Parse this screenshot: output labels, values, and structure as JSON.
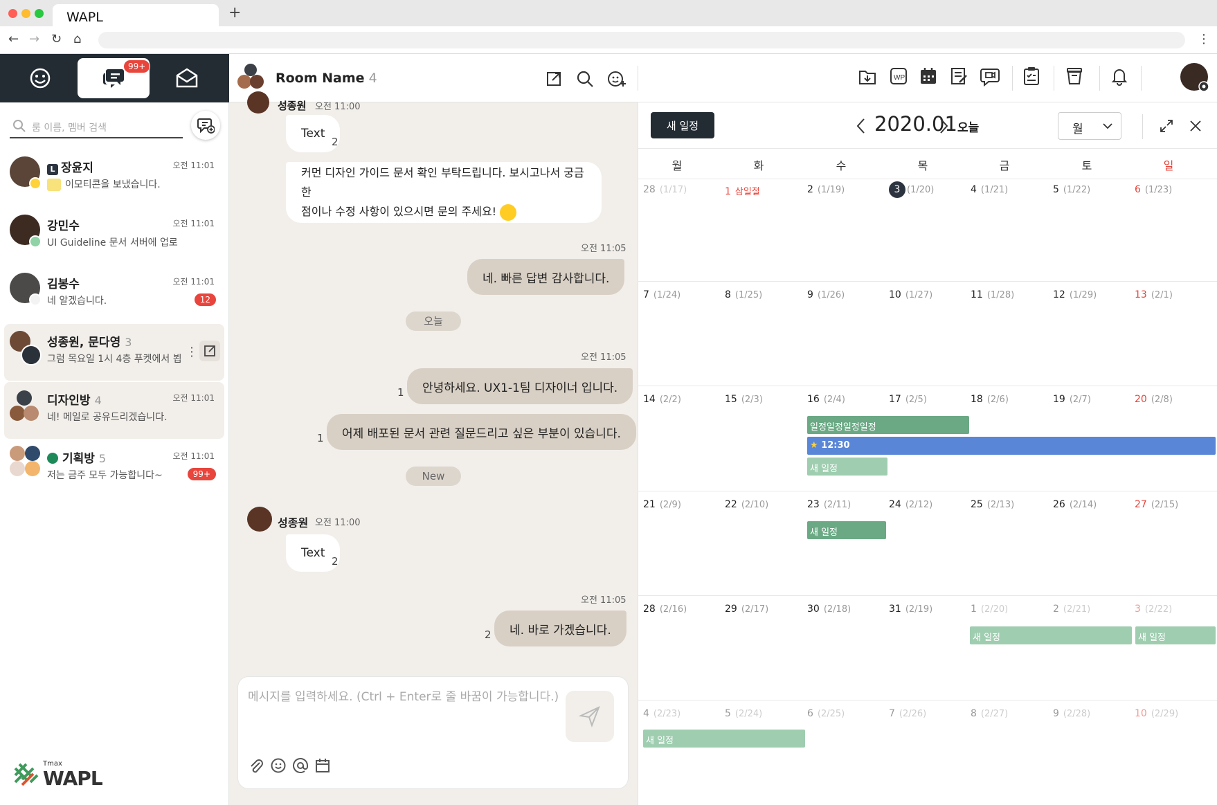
{
  "browser": {
    "tab_title": "WAPL",
    "new_tab": "+",
    "back": "←",
    "forward": "→",
    "reload": "↻",
    "home": "⌂",
    "menu": "⋮"
  },
  "left": {
    "tabs": [
      {
        "icon": "smile-icon"
      },
      {
        "icon": "chat-icon",
        "badge": "99+"
      },
      {
        "icon": "mail-icon"
      }
    ],
    "search_placeholder": "룸 이름, 멤버 검색",
    "rooms": [
      {
        "name": "장윤지",
        "count": "",
        "message": "이모티콘을 보냈습니다.",
        "time": "오전 11:01",
        "unread": ""
      },
      {
        "name": "강민수",
        "count": "",
        "message": "UI Guideline 문서 서버에 업로",
        "time": "오전 11:01",
        "unread": ""
      },
      {
        "name": "김봉수",
        "count": "",
        "message": "네 알겠습니다.",
        "time": "오전 11:01",
        "unread": "12"
      },
      {
        "name": "성종원, 문다영",
        "count": "3",
        "message": "그럼 목요일 1시 4층 푸켓에서 뵙",
        "time": "",
        "unread": ""
      },
      {
        "name": "디자인방",
        "count": "4",
        "message": "네! 메일로 공유드리겠습니다.",
        "time": "오전 11:01",
        "unread": ""
      },
      {
        "name": "기획방",
        "count": "5",
        "message": "저는 금주 모두 가능합니다~",
        "time": "오전 11:01",
        "unread": "99+"
      }
    ],
    "logo_brand": "Tmax",
    "logo_text": "WAPL"
  },
  "chat": {
    "room_name": "Room Name",
    "room_count": "4",
    "top_sender": "성종원",
    "top_time": "오전 11:00",
    "messages": [
      {
        "text": "Text",
        "read": "2"
      },
      {
        "line1": "커먼 디자인 가이드 문서 확인 부탁드립니다. 보시고나서 궁금한",
        "line2": "점이나 수정 사항이 있으시면 문의 주세요!"
      },
      {
        "time": "오전 11:05",
        "text": "네. 빠른 답변 감사합니다."
      },
      {
        "sep": "오늘"
      },
      {
        "time": "오전 11:05",
        "text": "안녕하세요. UX1-1팀 디자이너 입니다.",
        "read": "1"
      },
      {
        "text": "어제 배포된 문서 관련 질문드리고 싶은 부분이 있습니다.",
        "read": "1"
      },
      {
        "sep": "New"
      },
      {
        "sender": "성종원",
        "time": "오전 11:00"
      },
      {
        "text": "Text",
        "read": "2"
      },
      {
        "time": "오전 11:05",
        "text": "네. 바로 가겠습니다.",
        "read": "2"
      }
    ],
    "composer_placeholder": "메시지를 입력하세요. (Ctrl + Enter로 줄 바꿈이 가능합니다.)"
  },
  "calendar": {
    "new_event": "새 일정",
    "month": "2020.01",
    "today": "오늘",
    "view": "월",
    "weekdays": [
      "월",
      "화",
      "수",
      "목",
      "금",
      "토",
      "일"
    ],
    "weeks": [
      [
        [
          "28",
          "(1/17)"
        ],
        [
          "1",
          "삼일절"
        ],
        [
          "2",
          "(1/19)"
        ],
        [
          "3",
          "(1/20)"
        ],
        [
          "4",
          "(1/21)"
        ],
        [
          "5",
          "(1/22)"
        ],
        [
          "6",
          "(1/23)"
        ]
      ],
      [
        [
          "7",
          "(1/24)"
        ],
        [
          "8",
          "(1/25)"
        ],
        [
          "9",
          "(1/26)"
        ],
        [
          "10",
          "(1/27)"
        ],
        [
          "11",
          "(1/28)"
        ],
        [
          "12",
          "(1/29)"
        ],
        [
          "13",
          "(2/1)"
        ]
      ],
      [
        [
          "14",
          "(2/2)"
        ],
        [
          "15",
          "(2/3)"
        ],
        [
          "16",
          "(2/4)"
        ],
        [
          "17",
          "(2/5)"
        ],
        [
          "18",
          "(2/6)"
        ],
        [
          "19",
          "(2/7)"
        ],
        [
          "20",
          "(2/8)"
        ]
      ],
      [
        [
          "21",
          "(2/9)"
        ],
        [
          "22",
          "(2/10)"
        ],
        [
          "23",
          "(2/11)"
        ],
        [
          "24",
          "(2/12)"
        ],
        [
          "25",
          "(2/13)"
        ],
        [
          "26",
          "(2/14)"
        ],
        [
          "27",
          "(2/15)"
        ]
      ],
      [
        [
          "28",
          "(2/16)"
        ],
        [
          "29",
          "(2/17)"
        ],
        [
          "30",
          "(2/18)"
        ],
        [
          "31",
          "(2/19)"
        ],
        [
          "1",
          "(2/20)"
        ],
        [
          "2",
          "(2/21)"
        ],
        [
          "3",
          "(2/22)"
        ]
      ],
      [
        [
          "4",
          "(2/23)"
        ],
        [
          "5",
          "(2/24)"
        ],
        [
          "6",
          "(2/25)"
        ],
        [
          "7",
          "(2/26)"
        ],
        [
          "8",
          "(2/27)"
        ],
        [
          "9",
          "(2/28)"
        ],
        [
          "10",
          "(2/29)"
        ]
      ]
    ],
    "events": {
      "e1": "일정일정일정일정",
      "e2": "12:30",
      "e3": "새 일정",
      "e4": "새 일정",
      "e5": "새 일정",
      "e6": "새 일정",
      "e7": "새 일정"
    },
    "colors": {
      "sunday": "#e8453c",
      "holiday": "#e8453c",
      "event_green": "#6aa984",
      "event_blue": "#5a86d8",
      "event_light": "#9fcdb0",
      "today_circle": "#2c3440"
    }
  }
}
